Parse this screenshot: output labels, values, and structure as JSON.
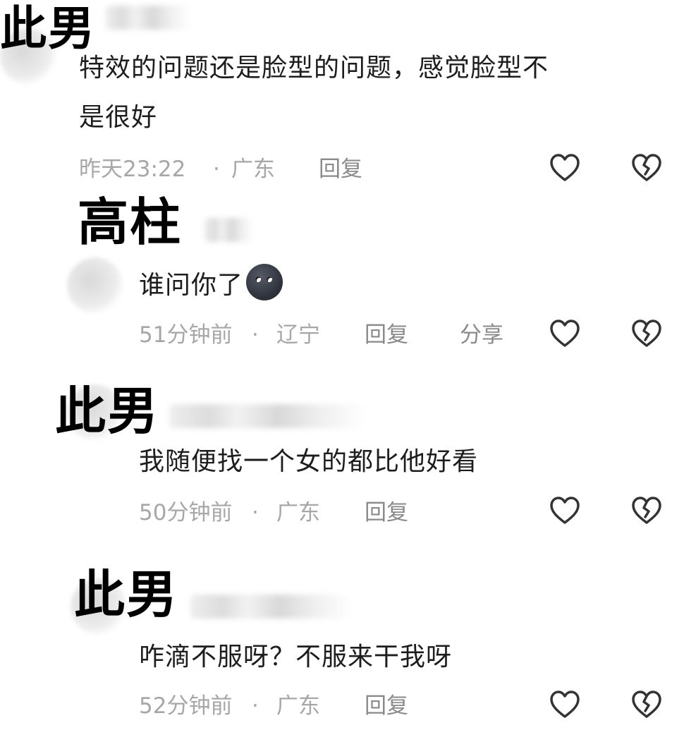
{
  "comments": [
    {
      "name_overlay": "此男",
      "text_line1": "特效的问题还是脸型的问题，感觉脸型不",
      "text_line2": "是很好",
      "time": "昨天23:22",
      "location": "广东",
      "reply_label": "回复",
      "share_label": ""
    },
    {
      "name_overlay": "高柱",
      "text_line1": "谁问你了",
      "emoji": "dark-moon-face-emoji",
      "time": "51分钟前",
      "location": "辽宁",
      "reply_label": "回复",
      "share_label": "分享"
    },
    {
      "name_overlay": "此男",
      "text_line1": "我随便找一个女的都比他好看",
      "time": "50分钟前",
      "location": "广东",
      "reply_label": "回复",
      "share_label": ""
    },
    {
      "name_overlay": "此男",
      "text_line1": "咋滴不服呀？不服来干我呀",
      "time": "52分钟前",
      "location": "广东",
      "reply_label": "回复",
      "share_label": ""
    }
  ],
  "separator": "·",
  "icons": {
    "like": "heart-outline-icon",
    "dislike": "broken-heart-icon"
  },
  "colors": {
    "text": "#1d1d1d",
    "meta": "#a7a7a7",
    "icon": "#333333"
  }
}
